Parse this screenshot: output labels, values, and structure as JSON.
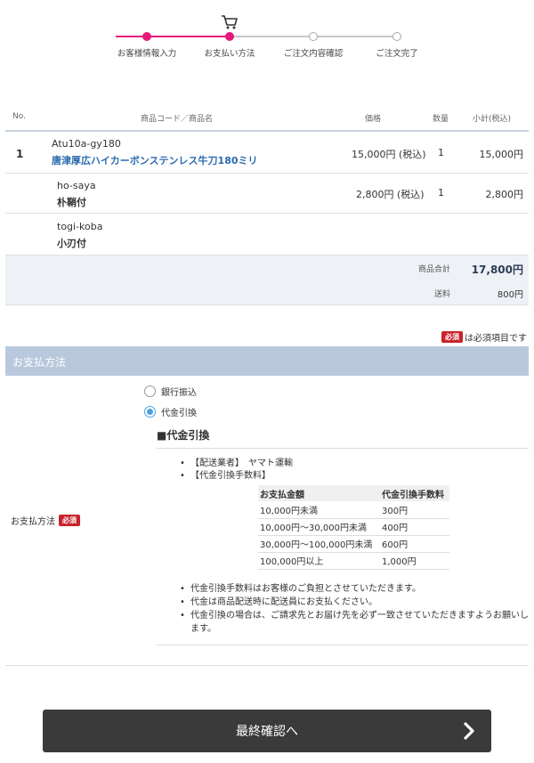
{
  "steps": [
    {
      "label": "お客様情報入力",
      "state": "done"
    },
    {
      "label": "お支払い方法",
      "state": "current"
    },
    {
      "label": "ご注文内容確認",
      "state": "todo"
    },
    {
      "label": "ご注文完了",
      "state": "todo"
    }
  ],
  "cart": {
    "headers": {
      "no": "No.",
      "product": "商品コード／商品名",
      "price": "価格",
      "qty": "数量",
      "subtotal": "小計(税込)"
    },
    "rows": [
      {
        "no": "1",
        "code": "Atu10a-gy180",
        "name": "唐津厚広ハイカーボンステンレス牛刀180ミリ",
        "price": "15,000円 (税込)",
        "qty": "1",
        "subtotal": "15,000円"
      },
      {
        "no": "",
        "code": "ho-saya",
        "name": "朴鞘付",
        "price": "2,800円 (税込)",
        "qty": "1",
        "subtotal": "2,800円"
      },
      {
        "no": "",
        "code": "togi-koba",
        "name": "小刃付",
        "price": "",
        "qty": "",
        "subtotal": ""
      }
    ],
    "totals": {
      "goods_label": "商品合計",
      "goods_value": "17,800円",
      "shipping_label": "送料",
      "shipping_value": "800円"
    }
  },
  "required_badge": "必須",
  "required_note": "は必須項目です",
  "payment": {
    "section_title": "お支払方法",
    "label": "お支払方法",
    "options": [
      {
        "label": "銀行振込",
        "checked": false
      },
      {
        "label": "代金引換",
        "checked": true
      }
    ],
    "cod": {
      "title": "■代金引換",
      "carrier": "【配送業者】　ヤマト運輸",
      "fee_label": "【代金引換手数料】",
      "fee_headers": [
        "お支払金額",
        "代金引換手数料"
      ],
      "fee_rows": [
        [
          "10,000円未満",
          "300円"
        ],
        [
          "10,000円～30,000円未満",
          "400円"
        ],
        [
          "30,000円～100,000円未満",
          "600円"
        ],
        [
          "100,000円以上",
          "1,000円"
        ]
      ],
      "notes": [
        "代金引換手数料はお客様のご負担とさせていただきます。",
        "代金は商品配送時に配送員にお支払ください。",
        "代金引換の場合は、ご請求先とお届け先を必ず一致させていただきますようお願いします。"
      ]
    }
  },
  "final_button": "最終確認へ",
  "colors": {
    "accent": "#e6197b",
    "link": "#2b6bb0",
    "section": "#b9c8dc",
    "badge": "#c8232c"
  }
}
